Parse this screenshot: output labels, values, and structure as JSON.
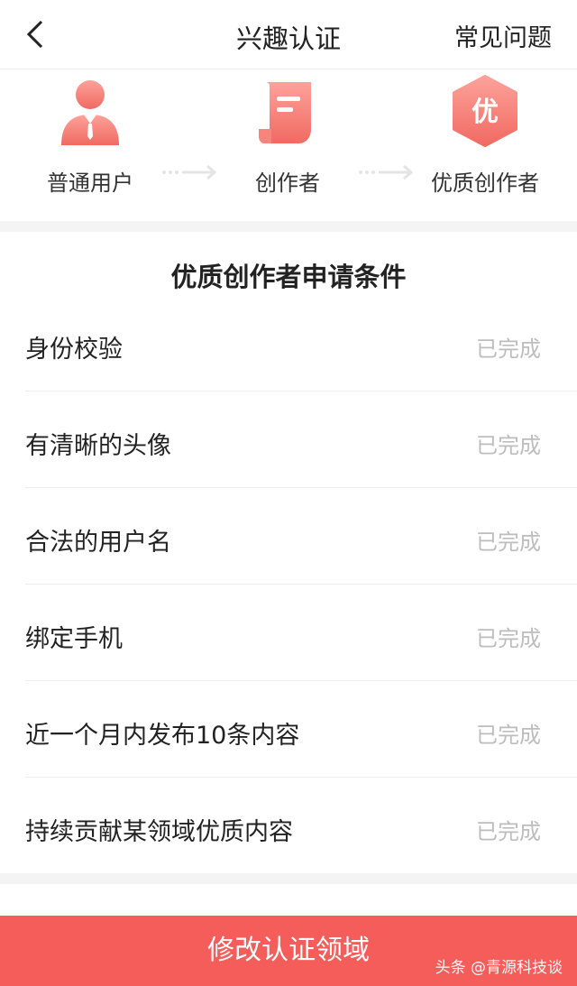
{
  "nav": {
    "title": "兴趣认证",
    "faq_label": "常见问题"
  },
  "steps": [
    {
      "label": "普通用户",
      "icon": "user-icon"
    },
    {
      "label": "创作者",
      "icon": "document-icon"
    },
    {
      "label": "优质创作者",
      "icon": "quality-badge-icon",
      "badge_text": "优"
    }
  ],
  "colors": {
    "accent": "#f55d5b",
    "icon_gradient_top": "#fda29a",
    "icon_gradient_bottom": "#f06a62",
    "status_gray": "#bdbdbd"
  },
  "conditions": {
    "title": "优质创作者申请条件",
    "items": [
      {
        "name": "身份校验",
        "status": "已完成"
      },
      {
        "name": "有清晰的头像",
        "status": "已完成"
      },
      {
        "name": "合法的用户名",
        "status": "已完成"
      },
      {
        "name": "绑定手机",
        "status": "已完成"
      },
      {
        "name": "近一个月内发布10条内容",
        "status": "已完成"
      },
      {
        "name": "持续贡献某领域优质内容",
        "status": "已完成"
      }
    ]
  },
  "action": {
    "button_label": "修改认证领域"
  },
  "watermark": "头条 @青源科技谈"
}
